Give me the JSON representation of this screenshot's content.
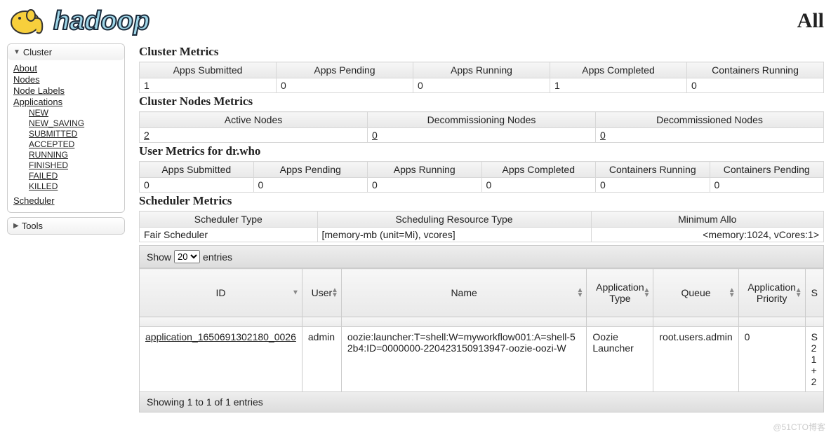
{
  "page_title": "All",
  "logo_text": "hadoop",
  "sidebar": {
    "cluster_label": "Cluster",
    "tools_label": "Tools",
    "links": {
      "about": "About",
      "nodes": "Nodes",
      "node_labels": "Node Labels",
      "applications": "Applications",
      "new": "NEW",
      "new_saving": "NEW_SAVING",
      "submitted": "SUBMITTED",
      "accepted": "ACCEPTED",
      "running": "RUNNING",
      "finished": "FINISHED",
      "failed": "FAILED",
      "killed": "KILLED",
      "scheduler": "Scheduler"
    }
  },
  "sections": {
    "cluster_metrics": "Cluster Metrics",
    "cluster_nodes": "Cluster Nodes Metrics",
    "user_metrics": "User Metrics for dr.who",
    "scheduler_metrics": "Scheduler Metrics"
  },
  "cm": {
    "h": {
      "submitted": "Apps Submitted",
      "pending": "Apps Pending",
      "running": "Apps Running",
      "completed": "Apps Completed",
      "containers": "Containers Running"
    },
    "v": {
      "submitted": "1",
      "pending": "0",
      "running": "0",
      "completed": "1",
      "containers": "0"
    }
  },
  "nm": {
    "h": {
      "active": "Active Nodes",
      "decommissioning": "Decommissioning Nodes",
      "decommissioned": "Decommissioned Nodes"
    },
    "v": {
      "active": "2",
      "decommissioning": "0",
      "decommissioned": "0"
    }
  },
  "um": {
    "h": {
      "submitted": "Apps Submitted",
      "pending": "Apps Pending",
      "running": "Apps Running",
      "completed": "Apps Completed",
      "crun": "Containers Running",
      "cpend": "Containers Pending"
    },
    "v": {
      "submitted": "0",
      "pending": "0",
      "running": "0",
      "completed": "0",
      "crun": "0",
      "cpend": "0"
    }
  },
  "sm": {
    "h": {
      "type": "Scheduler Type",
      "resource": "Scheduling Resource Type",
      "min": "Minimum Allo"
    },
    "v": {
      "type": "Fair Scheduler",
      "resource": "[memory-mb (unit=Mi), vcores]",
      "min": "<memory:1024, vCores:1>"
    }
  },
  "dt": {
    "show": "Show",
    "entries": "entries",
    "page_len": "20",
    "cols": {
      "id": "ID",
      "user": "User",
      "name": "Name",
      "type": "Application Type",
      "queue": "Queue",
      "priority": "Application Priority",
      "last": "S"
    },
    "row": {
      "id": "application_1650691302180_0026",
      "user": "admin",
      "name": "oozie:launcher:T=shell:W=myworkflow001:A=shell-52b4:ID=0000000-220423150913947-oozie-oozi-W",
      "type": "Oozie Launcher",
      "queue": "root.users.admin",
      "priority": "0",
      "last": "S\n2\n1\n+\n2"
    },
    "footer": "Showing 1 to 1 of 1 entries"
  },
  "watermark": "@51CTO博客"
}
